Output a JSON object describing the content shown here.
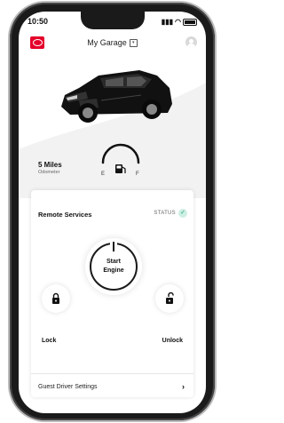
{
  "status_bar": {
    "time": "10:50"
  },
  "header": {
    "title": "My Garage"
  },
  "vehicle": {
    "odometer_value": "5 Miles",
    "odometer_label": "Odometer"
  },
  "fuel_gauge": {
    "empty": "E",
    "full": "F",
    "icon": "fuel-pump-icon"
  },
  "remote": {
    "title": "Remote Services",
    "status_label": "STATUS",
    "start_label_line1": "Start",
    "start_label_line2": "Engine",
    "lock_label": "Lock",
    "unlock_label": "Unlock"
  },
  "footer": {
    "guest_driver": "Guest Driver Settings"
  },
  "colors": {
    "brand_red": "#e4002b",
    "status_green": "#20a37a"
  }
}
